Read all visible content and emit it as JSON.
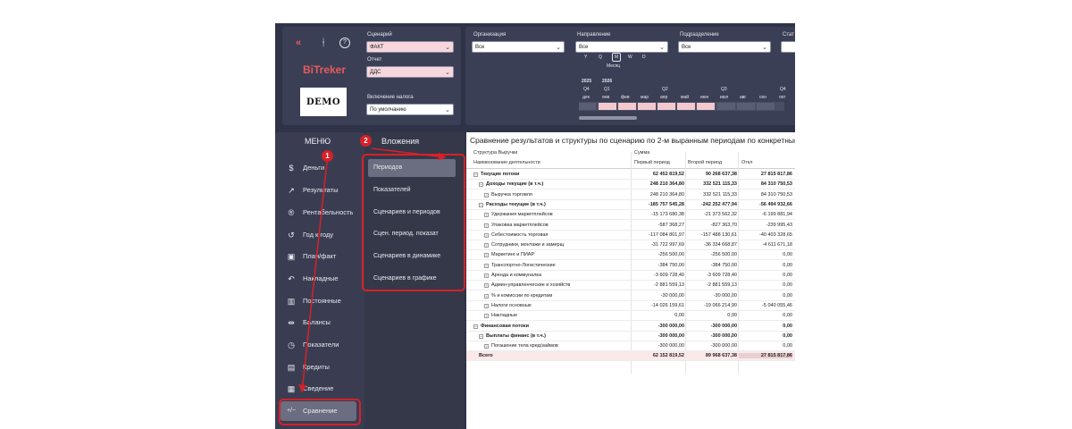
{
  "toolbar": {
    "icons": [
      "collapse-icon",
      "filter-clear-icon",
      "help-icon"
    ],
    "collapse_glyph": "«",
    "filter_glyph": "ᚽ",
    "help_glyph": "?"
  },
  "brand": {
    "title": "BiTreker",
    "demo_logo": "DEMO"
  },
  "scenario": {
    "scenario_label": "Сценарий",
    "scenario_value": "ФАКТ",
    "report_label": "Отчет",
    "report_value": "ДДС",
    "tax_label": "Включение налога",
    "tax_value": "По умолчанию"
  },
  "filters": {
    "org_label": "Организация",
    "org_value": "Все",
    "direction_label": "Направление",
    "direction_value": "Все",
    "division_label": "Подразделение",
    "division_value": "Все",
    "last_label": "Стат"
  },
  "date_slicer": {
    "levels": [
      "Y",
      "Q",
      "M",
      "W",
      "D"
    ],
    "level_caption": "Месяц",
    "years": [
      "2025",
      "2026"
    ],
    "quarters": [
      "Q4",
      "Q1",
      "Q2",
      "Q3",
      "Q4"
    ],
    "months": [
      "дек",
      "янв",
      "фев",
      "мар",
      "апр",
      "май",
      "июн",
      "июл",
      "авг",
      "сен",
      "окт"
    ]
  },
  "menu": {
    "title": "МЕНЮ",
    "items": [
      {
        "label": "Деньги",
        "icon": "$"
      },
      {
        "label": "Результаты",
        "icon": "↗"
      },
      {
        "label": "Рентабельность",
        "icon": "®"
      },
      {
        "label": "Год к году",
        "icon": "↺"
      },
      {
        "label": "План/факт",
        "icon": "▣"
      },
      {
        "label": "Накладные",
        "icon": "↶"
      },
      {
        "label": "Постоянные",
        "icon": "▥"
      },
      {
        "label": "Балансы",
        "icon": "⇹"
      },
      {
        "label": "Показатели",
        "icon": "◷"
      },
      {
        "label": "Кредиты",
        "icon": "▤"
      },
      {
        "label": "Сведение",
        "icon": "▦"
      },
      {
        "label": "Сравнение",
        "icon": "+/−"
      }
    ]
  },
  "submenu": {
    "title": "Вложения",
    "items": [
      "Периодов",
      "Показателей",
      "Сценариев и периодов",
      "Сцен. период. показат",
      "Сценариев в динамике",
      "Сценариев в графике"
    ]
  },
  "report": {
    "title": "Сравнение результатов и структуры по сценарию по 2-м выранным периодам по конкретным",
    "header_row1_left": "Структура Выручки",
    "header_row1_mid": "Сумма",
    "header_row2_left": "Наименование деятельности",
    "col1": "Первый период",
    "col2": "Второй период",
    "col3": "Откл",
    "rows": [
      {
        "name": "Текущие потоки",
        "v1": "62 452 819,52",
        "v2": "90 268 637,38",
        "v3": "27 815 817,86",
        "level": 0,
        "bold": true
      },
      {
        "name": "Доходы текущие (в т.ч.)",
        "v1": "248 210 364,80",
        "v2": "332 521 115,33",
        "v3": "84 310 750,53",
        "level": 1,
        "bold": true
      },
      {
        "name": "Выручка торговля",
        "v1": "248 210 364,80",
        "v2": "332 521 115,33",
        "v3": "84 310 750,53",
        "level": 2,
        "bold": false
      },
      {
        "name": "Расходы текущие (в т.ч.)",
        "v1": "-185 757 545,28",
        "v2": "-242 252 477,94",
        "v3": "-56 494 932,66",
        "level": 1,
        "bold": true
      },
      {
        "name": "Удержания маркетплейсов",
        "v1": "-15 173 680,38",
        "v2": "-21 373 562,32",
        "v3": "-6 199 881,94",
        "level": 2,
        "bold": false
      },
      {
        "name": "Упаковка маркетплейсов",
        "v1": "-587 368,27",
        "v2": "-827 363,70",
        "v3": "-239 995,43",
        "level": 2,
        "bold": false
      },
      {
        "name": "Себестоимость торговая",
        "v1": "-117 084 801,97",
        "v2": "-157 488 130,61",
        "v3": "-40 403 328,65",
        "level": 2,
        "bold": false
      },
      {
        "name": "Сотрудники, монтажи и замерщ",
        "v1": "-31 722 997,69",
        "v2": "-36 334 668,87",
        "v3": "-4 611 671,18",
        "level": 2,
        "bold": false
      },
      {
        "name": "Маркетинг и ПИАР",
        "v1": "-256 500,00",
        "v2": "-256 500,00",
        "v3": "0,00",
        "level": 2,
        "bold": false
      },
      {
        "name": "Транспортно-Логистические",
        "v1": "-384 750,00",
        "v2": "-384 750,00",
        "v3": "0,00",
        "level": 2,
        "bold": false
      },
      {
        "name": "Аренда и коммуналка",
        "v1": "-3 609 728,40",
        "v2": "-3 609 728,40",
        "v3": "0,00",
        "level": 2,
        "bold": false
      },
      {
        "name": "Админ-управленческие и хозяйств",
        "v1": "-2 881 559,13",
        "v2": "-2 881 559,13",
        "v3": "0,00",
        "level": 2,
        "bold": false
      },
      {
        "name": "% и комиссии по кредитам",
        "v1": "-30 000,00",
        "v2": "-30 000,00",
        "v3": "0,00",
        "level": 2,
        "bold": false
      },
      {
        "name": "Налоги основные",
        "v1": "-14 026 159,61",
        "v2": "-19 066 214,90",
        "v3": "-5 040 055,46",
        "level": 2,
        "bold": false
      },
      {
        "name": "Накладные",
        "v1": "0,00",
        "v2": "0,00",
        "v3": "0,00",
        "level": 2,
        "bold": false
      },
      {
        "name": "Финансовая потоки",
        "v1": "-300 000,00",
        "v2": "-300 000,00",
        "v3": "0,00",
        "level": 0,
        "bold": true
      },
      {
        "name": "Выплаты финанс (в т.ч.)",
        "v1": "-300 000,00",
        "v2": "-300 000,00",
        "v3": "0,00",
        "level": 1,
        "bold": true
      },
      {
        "name": "Погашение тела кред/займов",
        "v1": "-300 000,00",
        "v2": "-300 000,00",
        "v3": "0,00",
        "level": 2,
        "bold": false
      }
    ],
    "total": {
      "name": "Всего",
      "v1": "62 152 819,52",
      "v2": "89 968 637,38",
      "v3": "27 815 817,86"
    }
  },
  "annotations": {
    "badge1": "1",
    "badge2": "2"
  }
}
